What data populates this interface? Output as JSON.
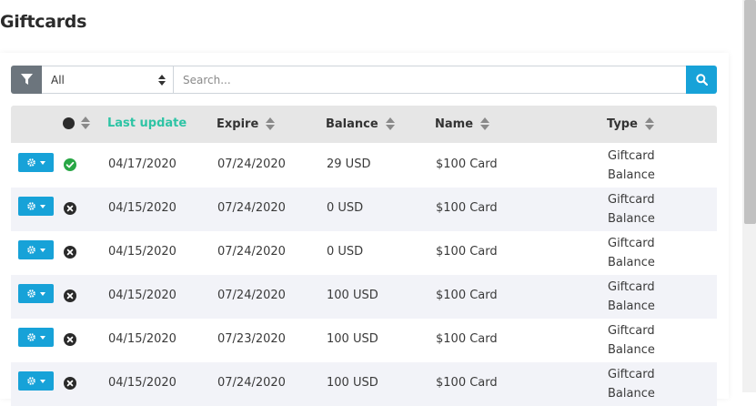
{
  "page": {
    "title": "Giftcards"
  },
  "toolbar": {
    "filter_icon": "filter-icon",
    "select_value": "All",
    "search_placeholder": "Search...",
    "search_icon": "search-icon"
  },
  "table": {
    "columns": [
      "Last update",
      "Expire",
      "Balance",
      "Name",
      "Type"
    ],
    "active_column": "Last update",
    "rows": [
      {
        "status": "active",
        "last_update": "04/17/2020",
        "expire": "07/24/2020",
        "balance": "29 USD",
        "name": "$100 Card",
        "type": "Giftcard Balance"
      },
      {
        "status": "inactive",
        "last_update": "04/15/2020",
        "expire": "07/24/2020",
        "balance": "0 USD",
        "name": "$100 Card",
        "type": "Giftcard Balance"
      },
      {
        "status": "inactive",
        "last_update": "04/15/2020",
        "expire": "07/24/2020",
        "balance": "0 USD",
        "name": "$100 Card",
        "type": "Giftcard Balance"
      },
      {
        "status": "inactive",
        "last_update": "04/15/2020",
        "expire": "07/24/2020",
        "balance": "100 USD",
        "name": "$100 Card",
        "type": "Giftcard Balance"
      },
      {
        "status": "inactive",
        "last_update": "04/15/2020",
        "expire": "07/23/2020",
        "balance": "100 USD",
        "name": "$100 Card",
        "type": "Giftcard Balance"
      },
      {
        "status": "inactive",
        "last_update": "04/15/2020",
        "expire": "07/24/2020",
        "balance": "100 USD",
        "name": "$100 Card",
        "type": "Giftcard Balance"
      }
    ]
  },
  "colors": {
    "accent": "#17a2d8",
    "active_header": "#2ec4a5",
    "active_status": "#28a745",
    "inactive_status": "#2b2b2b",
    "filter_button": "#6c757d"
  }
}
